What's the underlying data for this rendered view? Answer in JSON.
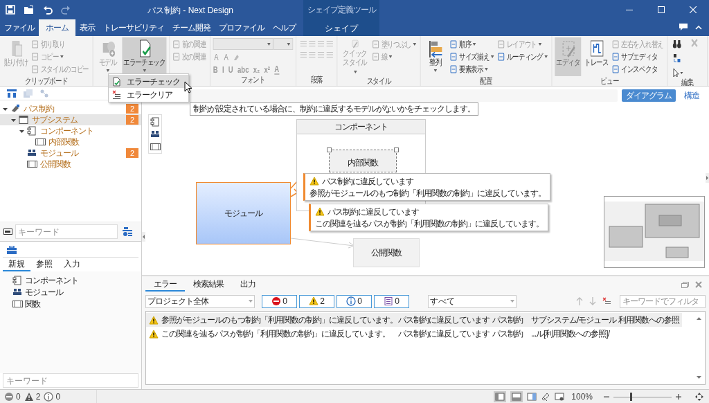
{
  "window": {
    "title": "パス制約 - Next Design",
    "context_group": "シェイプ定義ツール"
  },
  "menu_tabs": [
    {
      "label": "ファイル",
      "selected": false,
      "kind": "normal"
    },
    {
      "label": "ホーム",
      "selected": true,
      "kind": "normal"
    },
    {
      "label": "表示",
      "selected": false,
      "kind": "normal"
    },
    {
      "label": "トレーサビリティ",
      "selected": false,
      "kind": "normal"
    },
    {
      "label": "チーム開発",
      "selected": false,
      "kind": "normal"
    },
    {
      "label": "プロファイル",
      "selected": false,
      "kind": "normal"
    },
    {
      "label": "ヘルプ",
      "selected": false,
      "kind": "normal"
    },
    {
      "label": "シェイプ",
      "selected": false,
      "kind": "contextual"
    }
  ],
  "ribbon": {
    "groups": [
      {
        "label": "クリップボード",
        "items": [
          {
            "kind": "large",
            "label": "貼り付け",
            "disabled": true,
            "pressed": false
          },
          {
            "kind": "small",
            "label": "切り取り",
            "disabled": true
          },
          {
            "kind": "small",
            "label": "コピー",
            "disabled": true,
            "dropdown": true
          },
          {
            "kind": "small",
            "label": "スタイルのコピー",
            "disabled": true
          }
        ]
      },
      {
        "items": [
          {
            "kind": "large",
            "label": "モデル",
            "disabled": true,
            "pressed": false,
            "dropdown": true
          },
          {
            "kind": "large",
            "label": "エラーチェック",
            "disabled": false,
            "pressed": true,
            "dropdown": true
          }
        ]
      },
      {
        "items": [
          {
            "kind": "small",
            "label": "前の関連",
            "disabled": true
          },
          {
            "kind": "small",
            "label": "次の関連",
            "disabled": true
          }
        ]
      },
      {
        "label": "フォント",
        "items": [
          {
            "kind": "font"
          }
        ],
        "glyphs": [
          "A",
          "A",
          "B",
          "I",
          "U",
          "abc",
          "x₂",
          "x²",
          "A"
        ]
      },
      {
        "label": "段落",
        "items": [
          {
            "kind": "paragraph"
          }
        ]
      },
      {
        "label": "スタイル",
        "items": [
          {
            "kind": "large_wrapped",
            "label": "クイックスタイル",
            "disabled": true,
            "pressed": false,
            "dropdown": true
          },
          {
            "kind": "small",
            "label": "塗りつぶし",
            "disabled": true,
            "dropdown": true
          },
          {
            "kind": "small",
            "label": "線",
            "disabled": true,
            "dropdown": true
          }
        ]
      },
      {
        "label": "配置",
        "items": [
          {
            "kind": "large",
            "label": "整列",
            "disabled": false,
            "pressed": false,
            "dropdown": true
          },
          {
            "kind": "small",
            "label": "順序",
            "disabled": false,
            "dropdown": true
          },
          {
            "kind": "small",
            "label": "サイズ揃え",
            "disabled": false,
            "dropdown": true
          },
          {
            "kind": "small",
            "label": "要素表示",
            "disabled": false,
            "dropdown": true
          },
          {
            "kind": "small",
            "label": "レイアウト",
            "disabled": true,
            "dropdown": true
          },
          {
            "kind": "small",
            "label": "ルーティング",
            "disabled": false,
            "dropdown": true
          }
        ]
      },
      {
        "label": "ビュー",
        "items": [
          {
            "kind": "large",
            "label": "エディタ",
            "disabled": true,
            "pressed": true
          },
          {
            "kind": "large",
            "label": "トレース",
            "disabled": false,
            "pressed": false
          },
          {
            "kind": "small",
            "label": "左右を入れ替え",
            "disabled": true
          },
          {
            "kind": "small",
            "label": "サブエディタ",
            "disabled": false
          },
          {
            "kind": "small",
            "label": "インスペクタ",
            "disabled": false
          }
        ]
      },
      {
        "label": "編集",
        "items": [
          {
            "kind": "edit"
          }
        ]
      }
    ]
  },
  "dropdown_menu": {
    "items": [
      {
        "label": "エラーチェック",
        "selected": true
      },
      {
        "label": "エラークリア",
        "selected": false
      }
    ]
  },
  "tooltip": "制約が設定されている場合に、制約に違反するモデルがないかをチェックします。",
  "model_tree": [
    {
      "label": "パス制約",
      "badge": "2",
      "expanded": true,
      "selected": false,
      "children": [
        {
          "label": "サブシステム",
          "badge": "2",
          "expanded": true,
          "selected": true,
          "children": [
            {
              "label": "コンポーネント",
              "expanded": true,
              "selected": false,
              "children": [
                {
                  "label": "内部関数",
                  "selected": false
                }
              ]
            },
            {
              "label": "モジュール",
              "badge": "2",
              "selected": false
            },
            {
              "label": "公開関数",
              "selected": false
            }
          ]
        }
      ]
    }
  ],
  "tree_search": {
    "placeholder": "キーワード"
  },
  "toolbox": {
    "tabs": [
      {
        "label": "新規",
        "selected": true
      },
      {
        "label": "参照",
        "selected": false
      },
      {
        "label": "入力",
        "selected": false
      }
    ],
    "items": [
      "コンポーネント",
      "モジュール",
      "関数"
    ],
    "search": {
      "placeholder": "キーワード"
    }
  },
  "view_switch": [
    {
      "label": "ダイアグラム",
      "selected": true
    },
    {
      "label": "構造",
      "selected": false
    }
  ],
  "diagram": {
    "nodes": [
      {
        "kind": "container",
        "label": "コンポーネント"
      },
      {
        "kind": "selected",
        "label": "内部関数"
      },
      {
        "kind": "highlighted",
        "label": "モジュール"
      },
      {
        "kind": "plain",
        "label": "公開関数"
      }
    ],
    "callouts": [
      {
        "title": "パス制約に違反しています",
        "message": "参照がモジュールのもつ制約「利用関数の制約」に違反しています。"
      },
      {
        "title": "パス制約に違反しています",
        "message": "この関連を辿るパスが制約「利用関数の制約」に違反しています。"
      }
    ]
  },
  "error_panel": {
    "tabs": [
      {
        "label": "エラー",
        "selected": true
      },
      {
        "label": "検索結果",
        "selected": false
      },
      {
        "label": "出力",
        "selected": false
      }
    ],
    "scope": "プロジェクト全体",
    "filters": [
      {
        "kind": "error",
        "count": "0"
      },
      {
        "kind": "warning",
        "count": "2"
      },
      {
        "kind": "info",
        "count": "0"
      },
      {
        "kind": "message",
        "count": "0"
      }
    ],
    "category": "すべて",
    "search": {
      "placeholder": "キーワードでフィルタ"
    },
    "rows": [
      {
        "kind": "warning",
        "selected": true,
        "cells": [
          "参照がモジュールのもつ制約「利用関数の制約」に違反しています。",
          "パス制約に違反しています",
          "パス制約",
          "サブシステム/モジュール",
          "利用関数への参照"
        ]
      },
      {
        "kind": "warning",
        "selected": false,
        "cells": [
          "この関連を辿るパスが制約「利用関数の制約」に違反しています。",
          "パス制約に違反しています",
          "パス制約",
          "...ル[利用関数への参照]/"
        ]
      }
    ]
  },
  "status_bar": {
    "counts": [
      {
        "kind": "error",
        "count": "0"
      },
      {
        "kind": "warning",
        "count": "2"
      },
      {
        "kind": "info",
        "count": "0"
      }
    ],
    "zoom": {
      "reading": "100%",
      "level": 0.3
    }
  }
}
